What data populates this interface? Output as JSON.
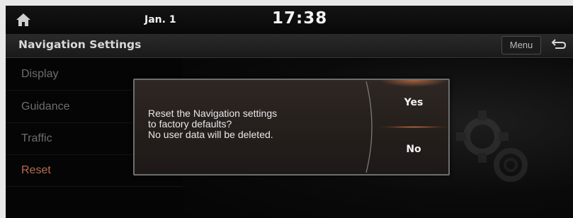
{
  "status_bar": {
    "home_icon": "home-icon",
    "date": "Jan. 1",
    "time": "17:38"
  },
  "header": {
    "title": "Navigation Settings",
    "menu_label": "Menu",
    "back_icon": "back-arrow-icon"
  },
  "sidebar": {
    "items": [
      {
        "label": "Display",
        "active": false
      },
      {
        "label": "Guidance",
        "active": false
      },
      {
        "label": "Traffic",
        "active": false
      },
      {
        "label": "Reset",
        "active": true
      }
    ]
  },
  "dialog": {
    "message_lines": [
      "Reset the Navigation settings",
      "to factory defaults?",
      "No user data will be deleted."
    ],
    "yes_label": "Yes",
    "no_label": "No"
  },
  "colors": {
    "accent": "#b46d4e",
    "dialog_bg": "#2a2421",
    "highlight": "#d27846"
  }
}
